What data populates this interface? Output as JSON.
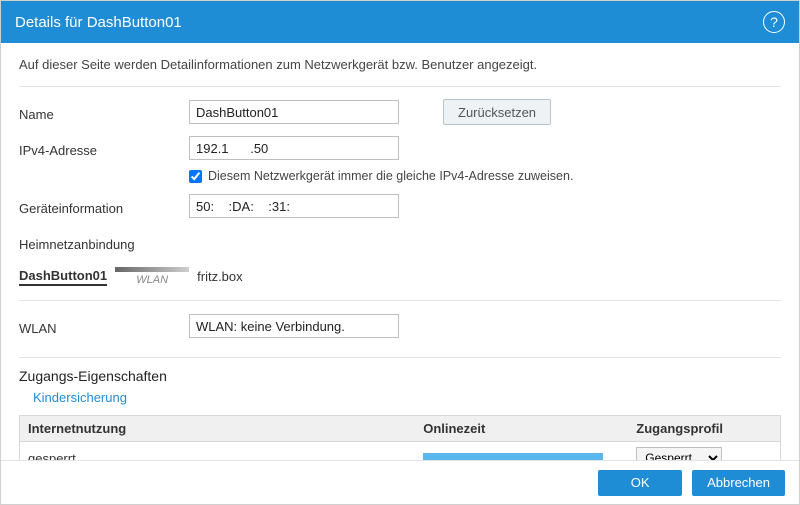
{
  "header": {
    "title": "Details für DashButton01",
    "help_icon_label": "?"
  },
  "intro": "Auf dieser Seite werden Detailinformationen zum Netzwerkgerät bzw. Benutzer angezeigt.",
  "form": {
    "name_label": "Name",
    "name_value": "DashButton01",
    "reset_label": "Zurücksetzen",
    "ipv4_label": "IPv4-Adresse",
    "ipv4_value": "192.1      .50",
    "static_ip_checkbox_label": "Diesem Netzwerkgerät immer die gleiche IPv4-Adresse zuweisen.",
    "static_ip_checked": true,
    "devinfo_label": "Geräteinformation",
    "devinfo_value": "50:    :DA:    :31:   ",
    "heimnetz_label": "Heimnetzanbindung"
  },
  "topology": {
    "node_a": "DashButton01",
    "link_label": "WLAN",
    "node_b": "fritz.box"
  },
  "wlan": {
    "label": "WLAN",
    "value": "WLAN: keine Verbindung."
  },
  "access": {
    "section_title": "Zugangs-Eigenschaften",
    "sublink": "Kindersicherung",
    "col_internet": "Internetnutzung",
    "col_onlinetime": "Onlinezeit",
    "col_profile": "Zugangsprofil",
    "internet_value": "gesperrt",
    "online_percent": 100,
    "profile_selected": "Gesperrt",
    "profile_options": [
      "Gesperrt"
    ]
  },
  "footer": {
    "ok": "OK",
    "cancel": "Abbrechen"
  }
}
